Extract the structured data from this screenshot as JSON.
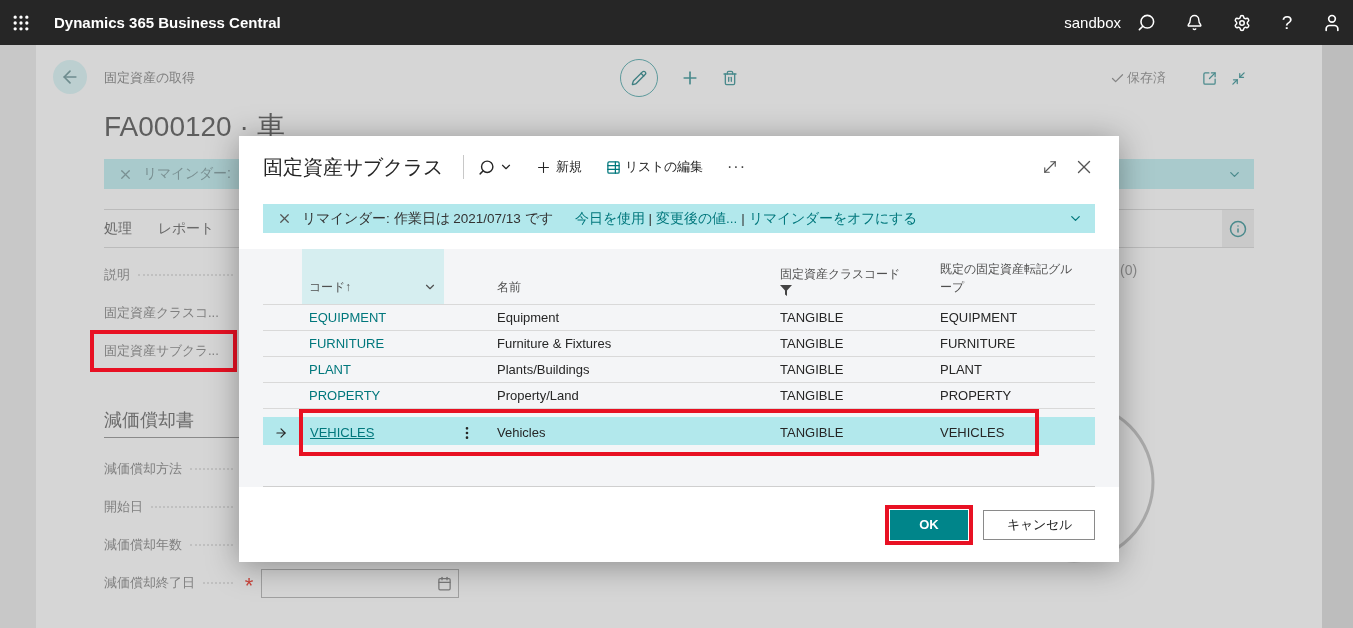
{
  "top_bar": {
    "app_title": "Dynamics 365 Business Central",
    "environment": "sandbox",
    "help": "?"
  },
  "page": {
    "breadcrumb": "固定資産の取得",
    "title": "FA000120 · 車",
    "saved_status": "保存済",
    "banner_text": "リマインダー:",
    "tabs": [
      "処理",
      "レポート"
    ],
    "general_fields": [
      {
        "label": "説明",
        "highlighted": false
      },
      {
        "label": "固定資産クラスコ...",
        "highlighted": false
      },
      {
        "label": "固定資産サブクラ...",
        "highlighted": true
      }
    ],
    "factbox_count": "(0)",
    "section_title": "減価償却書",
    "required_mark": "*",
    "depreciation_fields": [
      {
        "label": "減価償却方法",
        "required": false,
        "kind": "text"
      },
      {
        "label": "開始日",
        "kind": "text"
      },
      {
        "label": "減価償却年数",
        "required": false,
        "kind": "text"
      },
      {
        "label": "減価償却終了日",
        "required": true,
        "kind": "date"
      }
    ]
  },
  "dialog": {
    "title": "固定資産サブクラス",
    "toolbar": {
      "new_label": "新規",
      "edit_list_label": "リストの編集",
      "more": "···"
    },
    "banner": {
      "message": "リマインダー: 作業日は 2021/07/13 です",
      "actions": [
        "今日を使用",
        "変更後の値...",
        "リマインダーをオフにする"
      ],
      "separator": "|"
    },
    "table": {
      "columns": [
        {
          "label": "コード↑",
          "kind": "sorted"
        },
        {
          "label": "名前",
          "kind": "plain"
        },
        {
          "label": "固定資産クラスコード",
          "kind": "filtered"
        },
        {
          "label": "既定の固定資産転記グループ",
          "kind": "plain"
        }
      ],
      "rows": [
        {
          "code": "EQUIPMENT",
          "name": "Equipment",
          "class_code": "TANGIBLE",
          "posting_group": "EQUIPMENT",
          "selected": false,
          "highlighted": false
        },
        {
          "code": "FURNITURE",
          "name": "Furniture & Fixtures",
          "class_code": "TANGIBLE",
          "posting_group": "FURNITURE",
          "selected": false,
          "highlighted": false
        },
        {
          "code": "PLANT",
          "name": "Plants/Buildings",
          "class_code": "TANGIBLE",
          "posting_group": "PLANT",
          "selected": false,
          "highlighted": false
        },
        {
          "code": "PROPERTY",
          "name": "Property/Land",
          "class_code": "TANGIBLE",
          "posting_group": "PROPERTY",
          "selected": false,
          "highlighted": false
        },
        {
          "code": "VEHICLES",
          "name": "Vehicles",
          "class_code": "TANGIBLE",
          "posting_group": "VEHICLES",
          "selected": true,
          "highlighted": true
        }
      ]
    },
    "buttons": [
      {
        "label": "OK",
        "kind": "primary",
        "highlighted": true
      },
      {
        "label": "キャンセル",
        "kind": "secondary",
        "highlighted": false
      }
    ]
  }
}
